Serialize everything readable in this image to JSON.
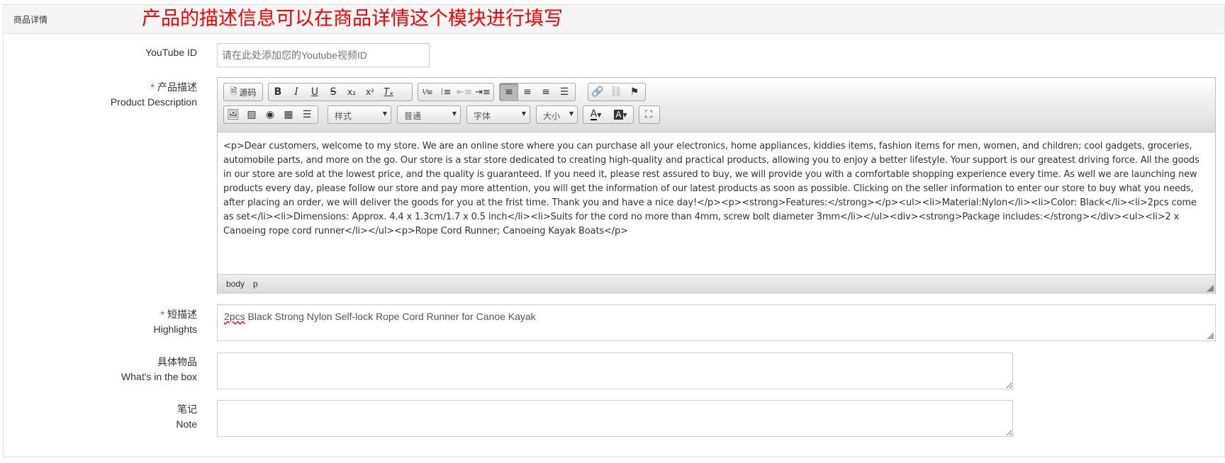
{
  "panel": {
    "title": "商品详情",
    "annotation": "产品的描述信息可以在商品详情这个模块进行填写"
  },
  "youtube": {
    "label": "YouTube ID",
    "placeholder": "请在此处添加您的Youtube视频ID"
  },
  "description": {
    "required_mark": "*",
    "label_cn": "产品描述",
    "label_en": "Product Description",
    "toolbar": {
      "source_label": "源码",
      "style_label": "样式",
      "format_label": "普通",
      "font_label": "字体",
      "size_label": "大小"
    },
    "content": "<p>Dear customers, welcome to my store. We are an online store where you can purchase all your electronics, home appliances, kiddies items, fashion items for men, women, and children; cool gadgets, groceries, automobile parts, and more on the go. Our store is a star store dedicated to creating high-quality and practical products, allowing you to enjoy a better lifestyle. Your support is our greatest driving force. All the goods in our store are sold at the lowest price, and the quality is guaranteed. If you need it, please rest assured to buy, we will provide you with a comfortable shopping experience every time. As well we are launching new products every day, please follow our store and pay more attention, you will get the information of our latest products as soon as possible. Clicking on the seller information to enter our store to buy what you needs, after placing an order, we will deliver the goods for you at the frist time. Thank you and have a nice day!</p><p><strong>Features:</strong></p><ul><li>Material:Nylon</li><li>Color: Black</li><li>2pcs come as set</li><li>Dimensions: Approx. 4.4 x 1.3cm/1.7 x 0.5 inch</li><li>Suits for the cord no more than 4mm, screw bolt diameter 3mm</li></ul><div><strong>Package includes:</strong></div><ul><li>2 x Canoeing rope cord runner</li></ul><p>Rope Cord Runner; Canoeing Kayak Boats</p>",
    "path": [
      "body",
      "p"
    ]
  },
  "highlights": {
    "required_mark": "*",
    "label_cn": "短描述",
    "label_en": "Highlights",
    "value_prefix": "2pcs",
    "value_rest": " Black Strong Nylon Self-lock Rope Cord Runner for Canoe Kayak"
  },
  "in_box": {
    "label_cn": "具体物品",
    "label_en": "What's in the box",
    "value": ""
  },
  "note": {
    "label_cn": "笔记",
    "label_en": "Note",
    "value": ""
  }
}
